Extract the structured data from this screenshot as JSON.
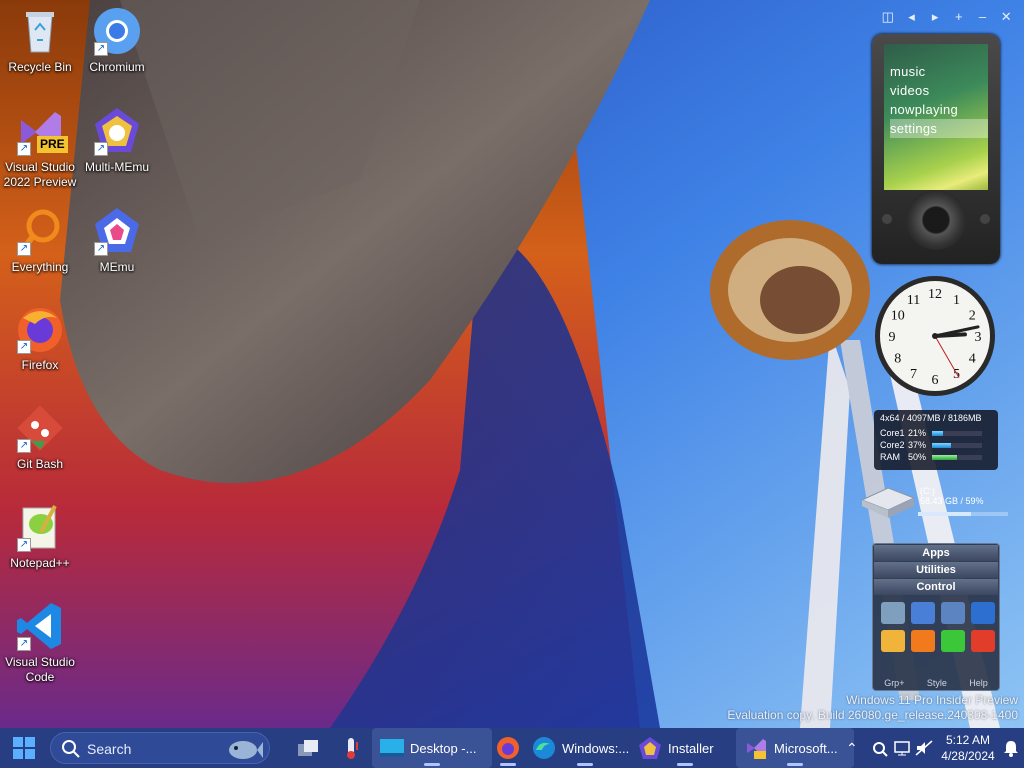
{
  "desktop": {
    "icons": [
      {
        "label": "Recycle Bin"
      },
      {
        "label": "Chromium"
      },
      {
        "label": "Visual Studio 2022 Preview"
      },
      {
        "label": "Multi-MEmu"
      },
      {
        "label": "Everything"
      },
      {
        "label": "MEmu"
      },
      {
        "label": "Firefox"
      },
      {
        "label": "Git Bash"
      },
      {
        "label": "Notepad++"
      },
      {
        "label": "Visual Studio Code"
      }
    ],
    "vs_badge": "PRE"
  },
  "gadgets": {
    "toolbar": {
      "icons": [
        "window-icon",
        "back-icon",
        "forward-icon",
        "plus-icon",
        "minimize-icon",
        "close-icon"
      ],
      "buttons": [
        "◫",
        "◂",
        "▸",
        "+",
        "–",
        "✕"
      ]
    },
    "zune": {
      "menu": [
        "music",
        "videos",
        "nowplaying",
        "settings"
      ],
      "selected": "settings"
    },
    "clock": {
      "numbers": [
        "12",
        "1",
        "2",
        "3",
        "4",
        "5",
        "6",
        "7",
        "8",
        "9",
        "10",
        "11"
      ],
      "hour": 2.9,
      "minute": 13,
      "second": 25
    },
    "sysmon": {
      "header": "4x64 / 4097MB / 8186MB",
      "rows": [
        {
          "name": "Core1",
          "value": "21%",
          "level": 0.21
        },
        {
          "name": "Core2",
          "value": "37%",
          "level": 0.37
        },
        {
          "name": "RAM",
          "value": "50%",
          "level": 0.5
        }
      ]
    },
    "drive": {
      "name": "(C:)",
      "usage": "58.43 GB / 59%",
      "level": 0.59
    },
    "launcher": {
      "headers": [
        "Apps",
        "Utilities",
        "Control"
      ],
      "footer": [
        "Grp+",
        "Style",
        "Help"
      ],
      "tile_colors": [
        "#7f9fbf",
        "#4a7fd8",
        "#5c84c0",
        "#2d6fd0",
        "#f0b43a",
        "#f07a1c",
        "#3cc63a",
        "#e23c2a"
      ]
    }
  },
  "watermark": {
    "line1": "Windows 11 Pro Insider Preview",
    "line2": "Evaluation copy. Build 26080.ge_release.240308-1400"
  },
  "taskbar": {
    "search_placeholder": "Search",
    "apps": [
      {
        "label": "Desktop -..."
      },
      {
        "label": "Windows:..."
      },
      {
        "label": "Installer"
      },
      {
        "label": "Microsoft..."
      }
    ],
    "time": "5:12 AM",
    "date": "4/28/2024"
  },
  "colors": {
    "taskbar": "#273e83",
    "accent": "#3a7bff"
  }
}
